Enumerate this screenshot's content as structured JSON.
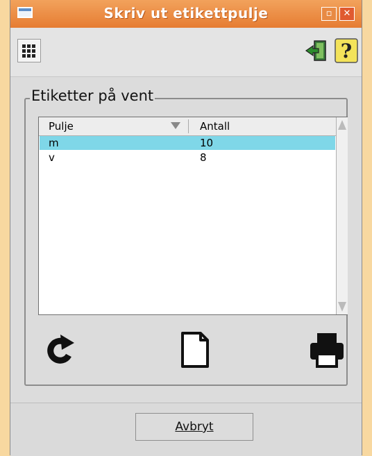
{
  "window": {
    "title": "Skriv ut etikettpulje"
  },
  "group": {
    "legend": "Etiketter på vent"
  },
  "list": {
    "columns": [
      "Pulje",
      "Antall"
    ],
    "rows": [
      {
        "pulje": "m",
        "antall": "10",
        "selected": true
      },
      {
        "pulje": "v",
        "antall": "8",
        "selected": false
      }
    ]
  },
  "footer": {
    "cancel_label": "Avbryt"
  },
  "colors": {
    "titlebar": "#e67c32",
    "selection": "#7fd7e8",
    "background": "#f8d8a0"
  },
  "icons": [
    "grid-icon",
    "exit-icon",
    "help-icon",
    "refresh-icon",
    "new-document-icon",
    "printer-icon"
  ]
}
